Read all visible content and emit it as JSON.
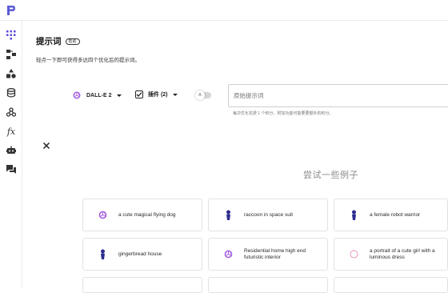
{
  "header": {
    "logo_icon": "app-logo-icon"
  },
  "sidebar": {
    "items": [
      {
        "icon": "prompt-grid-icon"
      },
      {
        "icon": "flow-icon"
      },
      {
        "icon": "shapes-icon"
      },
      {
        "icon": "database-icon"
      },
      {
        "icon": "webhook-icon"
      },
      {
        "icon": "function-icon",
        "text": "fx"
      },
      {
        "icon": "robot-icon"
      },
      {
        "icon": "chat-icon"
      }
    ]
  },
  "page": {
    "title": "提示词",
    "help_badge": "帮助",
    "subtitle": "轻点一下即可获得多达四个优化后的提示词。"
  },
  "controls": {
    "model_label": "DALL-E 2",
    "plugin_label": "插件 (2)",
    "toggle_badge": "A",
    "input_placeholder": "原始提示词",
    "hint": "每次优化花费 1 个积分，附加功能可能要要额外的积分。"
  },
  "examples": {
    "title": "尝试一些例子",
    "cards": [
      {
        "text": "a cute magical flying dog",
        "icon": "openai-icon"
      },
      {
        "text": "raccoon in space suit",
        "icon": "figure-icon"
      },
      {
        "text": "a female robot warrior",
        "icon": "figure-icon"
      },
      {
        "text": "gingerbread house",
        "icon": "figure-icon"
      },
      {
        "text": "Residential home high end futuristic interior",
        "icon": "openai-icon"
      },
      {
        "text": "a portrait of a cute girl with a luminous dress",
        "icon": "spinner-icon"
      }
    ]
  },
  "colors": {
    "accent": "#7c4dff",
    "icon_dark": "#2d2d8f",
    "border": "#e2e2e6"
  }
}
